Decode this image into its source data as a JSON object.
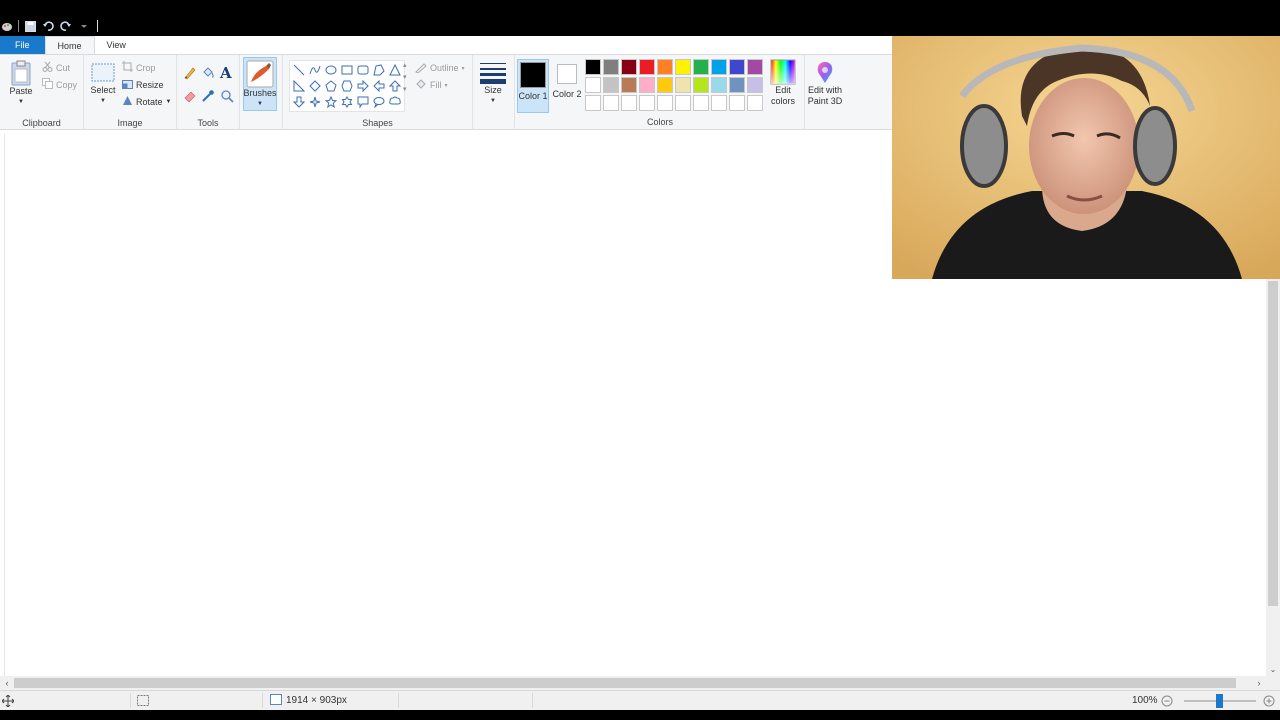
{
  "tabs": {
    "file": "File",
    "home": "Home",
    "view": "View"
  },
  "clipboard": {
    "label": "Clipboard",
    "paste": "Paste",
    "cut": "Cut",
    "copy": "Copy"
  },
  "image": {
    "label": "Image",
    "select": "Select",
    "crop": "Crop",
    "resize": "Resize",
    "rotate": "Rotate"
  },
  "tools": {
    "label": "Tools"
  },
  "brushes": {
    "label": "Brushes"
  },
  "shapes": {
    "label": "Shapes",
    "outline": "Outline",
    "fill": "Fill"
  },
  "size": {
    "label": "Size"
  },
  "colors": {
    "label": "Colors",
    "color1": "Color 1",
    "color2": "Color 2",
    "edit_colors": "Edit colors",
    "edit_paint3d": "Edit with Paint 3D",
    "color1_value": "#000000",
    "color2_value": "#ffffff",
    "palette_row1": [
      "#000000",
      "#7f7f7f",
      "#880015",
      "#ed1c24",
      "#ff7f27",
      "#fff200",
      "#22b14c",
      "#00a2e8",
      "#3f48cc",
      "#a349a4"
    ],
    "palette_row2": [
      "#ffffff",
      "#c3c3c3",
      "#b97a57",
      "#ffaec9",
      "#ffc90e",
      "#efe4b0",
      "#b5e61d",
      "#99d9ea",
      "#7092be",
      "#c8bfe7"
    ],
    "palette_row3": [
      "#ffffff",
      "#ffffff",
      "#ffffff",
      "#ffffff",
      "#ffffff",
      "#ffffff",
      "#ffffff",
      "#ffffff",
      "#ffffff",
      "#ffffff"
    ]
  },
  "status": {
    "dimensions": "1914 × 903px",
    "zoom": "100%"
  },
  "icons": {
    "paste": "clipboard-icon",
    "cut": "scissors-icon",
    "copy": "copy-icon",
    "select": "select-rect-icon",
    "crop": "crop-icon",
    "resize": "resize-icon",
    "rotate": "rotate-icon",
    "pencil": "pencil-icon",
    "fill": "paint-bucket-icon",
    "text": "text-icon",
    "eraser": "eraser-icon",
    "picker": "color-picker-icon",
    "magnifier": "magnifier-icon"
  }
}
